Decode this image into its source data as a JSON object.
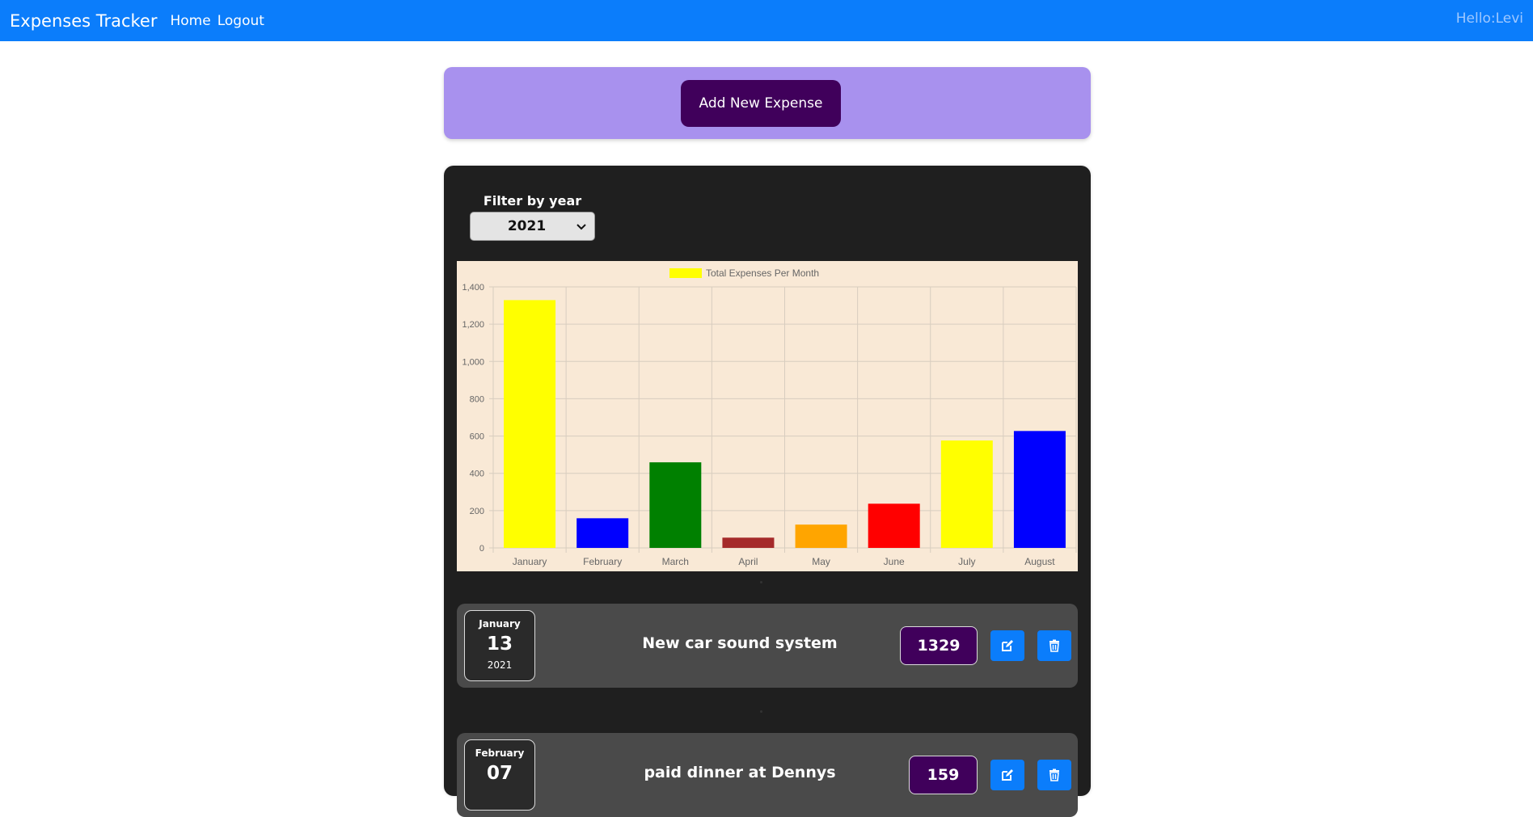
{
  "navbar": {
    "brand": "Expenses Tracker",
    "links": [
      "Home",
      "Logout"
    ],
    "greeting": "Hello:Levi",
    "color": "#0b7dfb"
  },
  "add_panel": {
    "button_label": "Add New Expense",
    "panel_color": "#a891ee",
    "button_color": "#40005b"
  },
  "filter": {
    "label": "Filter by year",
    "selected": "2021"
  },
  "chart_data": {
    "type": "bar",
    "legend": "Total Expenses Per Month",
    "legend_placement": "top-center",
    "categories": [
      "January",
      "February",
      "March",
      "April",
      "May",
      "June",
      "July",
      "August"
    ],
    "values": [
      1329,
      159,
      459,
      55,
      125,
      237,
      576,
      627
    ],
    "colors": [
      "#ffff00",
      "#0000ff",
      "#008000",
      "#a52a2a",
      "#ffa500",
      "#ff0000",
      "#ffff00",
      "#0000ff"
    ],
    "legend_color": "#ffff00",
    "ylim": [
      0,
      1400
    ],
    "yticks": [
      0,
      200,
      400,
      600,
      800,
      1000,
      1200,
      1400
    ],
    "ytick_labels": [
      "0",
      "200",
      "400",
      "600",
      "800",
      "1,000",
      "1,200",
      "1,400"
    ],
    "grid": true,
    "background": "#f9e9d6"
  },
  "expenses": [
    {
      "month": "January",
      "day": "13",
      "year": "2021",
      "title": "New car sound system",
      "amount": "1329"
    },
    {
      "month": "February",
      "day": "07",
      "year": "",
      "title": "paid dinner at Dennys",
      "amount": "159"
    }
  ],
  "icons": {
    "edit": "edit-icon",
    "delete": "trash-icon"
  }
}
